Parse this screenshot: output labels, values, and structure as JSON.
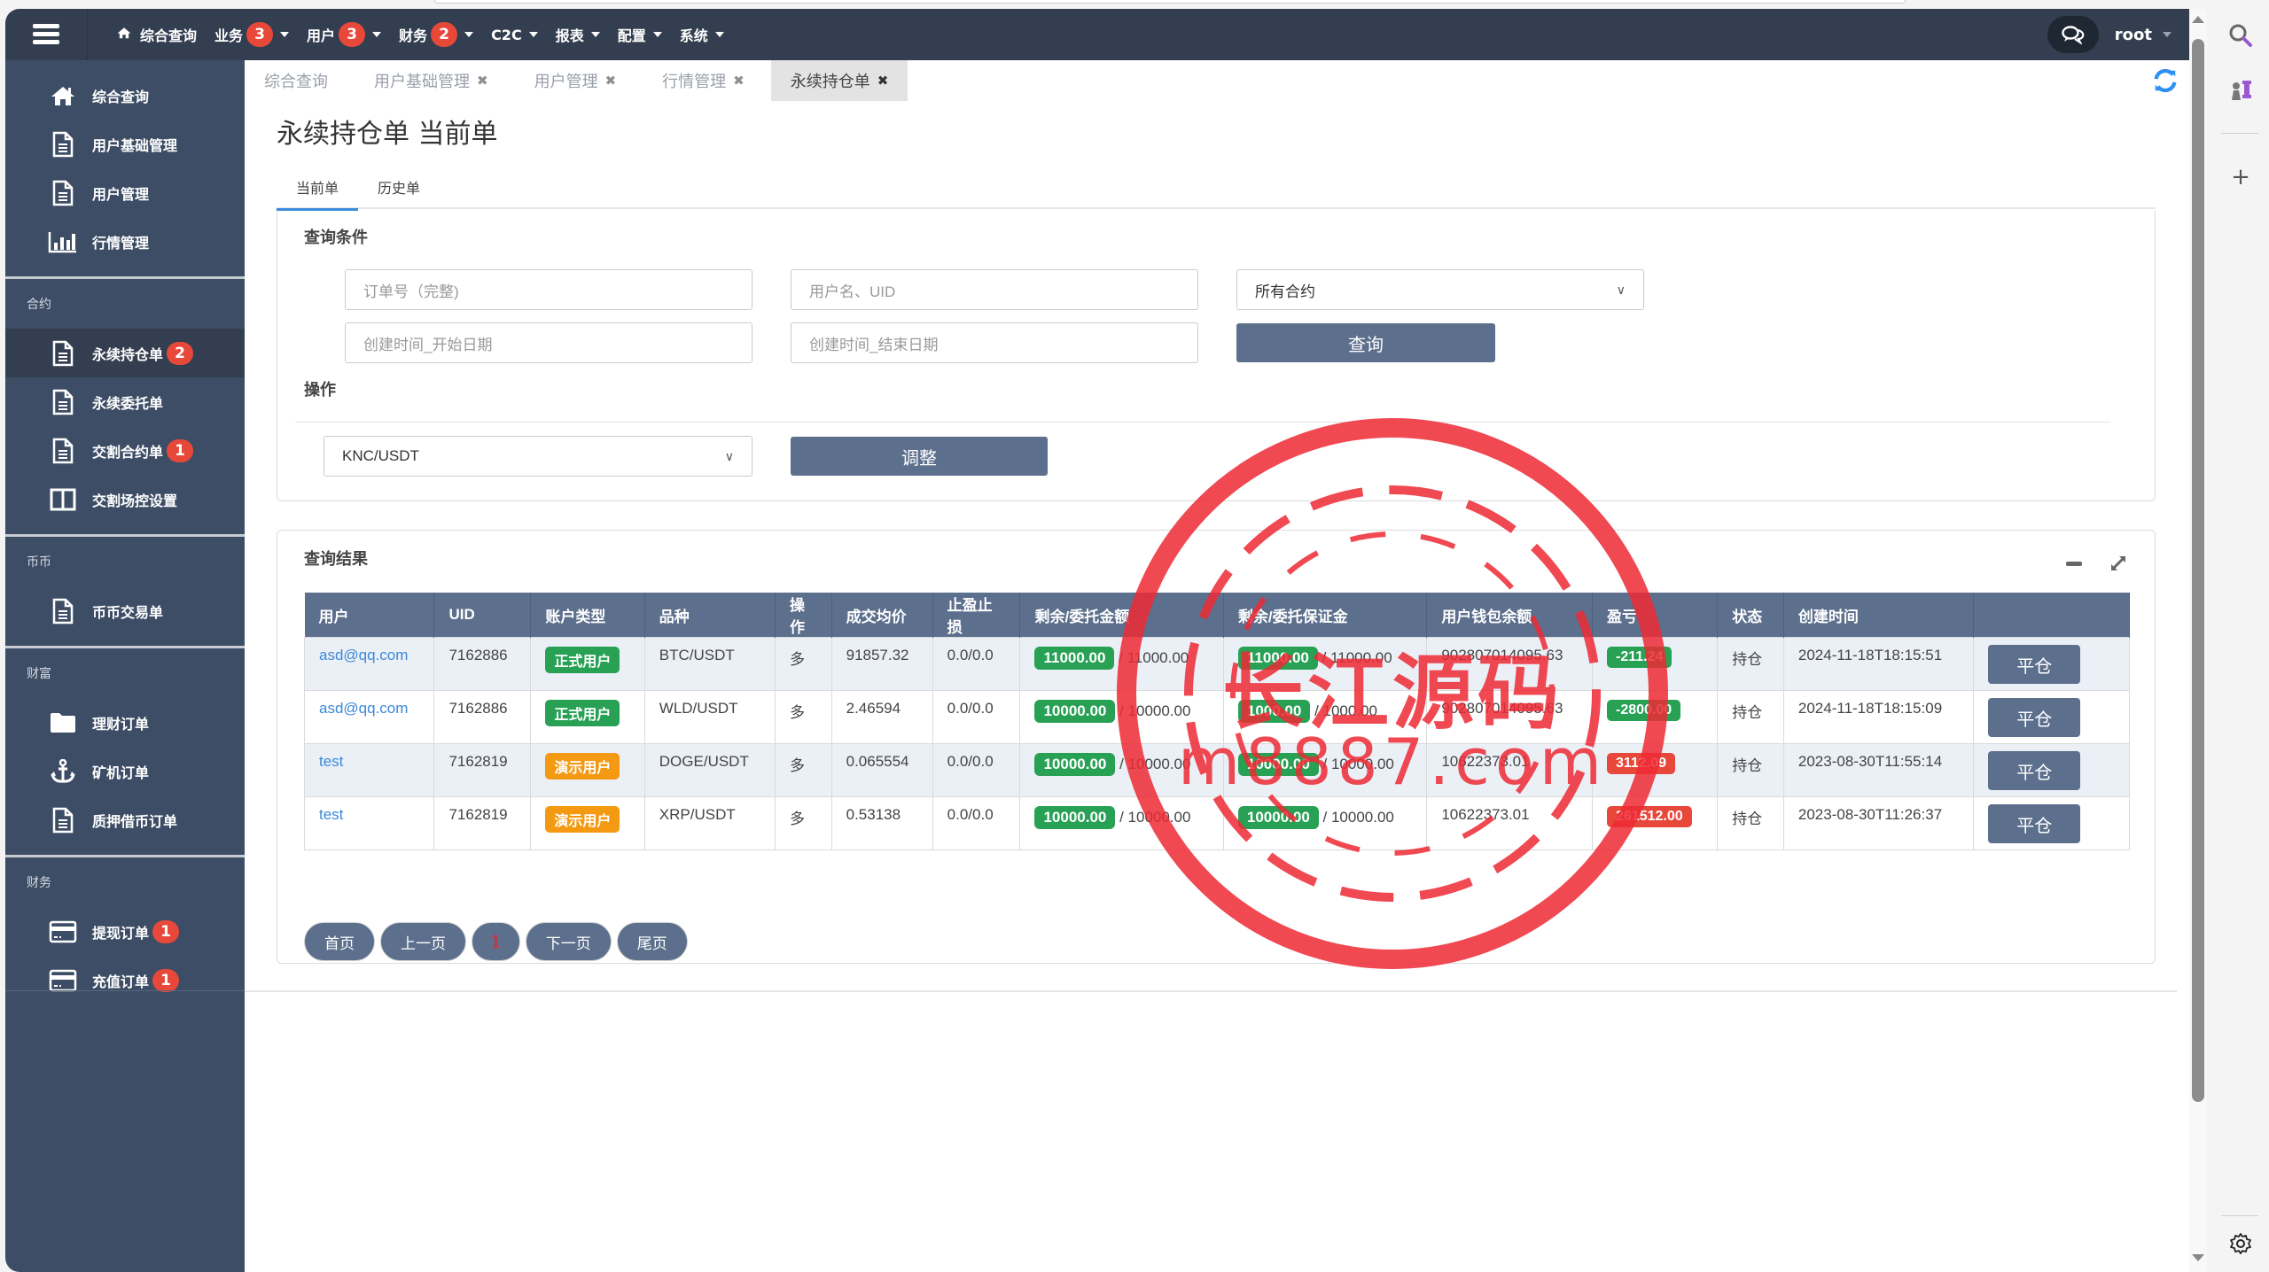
{
  "topnav": {
    "items": [
      {
        "label": "综合查询",
        "icon": "home-icon",
        "badge": null,
        "dropdown": false
      },
      {
        "label": "业务",
        "badge": "3",
        "dropdown": true
      },
      {
        "label": "用户",
        "badge": "3",
        "dropdown": true
      },
      {
        "label": "财务",
        "badge": "2",
        "dropdown": true
      },
      {
        "label": "C2C",
        "badge": null,
        "dropdown": true
      },
      {
        "label": "报表",
        "badge": null,
        "dropdown": true
      },
      {
        "label": "配置",
        "badge": null,
        "dropdown": true
      },
      {
        "label": "系统",
        "badge": null,
        "dropdown": true
      }
    ],
    "user": "root",
    "chat_icon": "chat-bubbles-icon"
  },
  "sidebar": {
    "top_items": [
      {
        "label": "综合查询",
        "icon": "home-icon"
      },
      {
        "label": "用户基础管理",
        "icon": "document-icon"
      },
      {
        "label": "用户管理",
        "icon": "document-icon"
      },
      {
        "label": "行情管理",
        "icon": "bar-chart-icon"
      }
    ],
    "groups": [
      {
        "title": "合约",
        "items": [
          {
            "label": "永续持仓单",
            "icon": "document-icon",
            "badge": "2",
            "active": true
          },
          {
            "label": "永续委托单",
            "icon": "document-icon",
            "badge": null
          },
          {
            "label": "交割合约单",
            "icon": "document-icon",
            "badge": "1"
          },
          {
            "label": "交割场控设置",
            "icon": "columns-icon",
            "badge": null
          }
        ]
      },
      {
        "title": "币币",
        "items": [
          {
            "label": "币币交易单",
            "icon": "document-icon",
            "badge": null
          }
        ]
      },
      {
        "title": "财富",
        "items": [
          {
            "label": "理财订单",
            "icon": "folder-icon",
            "badge": null
          },
          {
            "label": "矿机订单",
            "icon": "anchor-icon",
            "badge": null
          },
          {
            "label": "质押借币订单",
            "icon": "document-icon",
            "badge": null
          }
        ]
      },
      {
        "title": "财务",
        "items": [
          {
            "label": "提现订单",
            "icon": "credit-card-icon",
            "badge": "1"
          },
          {
            "label": "充值订单",
            "icon": "credit-card-icon",
            "badge": "1"
          }
        ]
      }
    ]
  },
  "tabs": [
    {
      "label": "综合查询",
      "closable": false,
      "active": false
    },
    {
      "label": "用户基础管理",
      "closable": true,
      "active": false
    },
    {
      "label": "用户管理",
      "closable": true,
      "active": false
    },
    {
      "label": "行情管理",
      "closable": true,
      "active": false
    },
    {
      "label": "永续持仓单",
      "closable": true,
      "active": true
    }
  ],
  "tab_close_glyph": "✖",
  "page_title": "永续持仓单 当前单",
  "subtabs": [
    {
      "label": "当前单",
      "active": true
    },
    {
      "label": "历史单",
      "active": false
    }
  ],
  "query": {
    "title": "查询条件",
    "order_no_placeholder": "订单号（完整)",
    "user_placeholder": "用户名、UID",
    "contract_select": "所有合约",
    "start_date_placeholder": "创建时间_开始日期",
    "end_date_placeholder": "创建时间_结束日期",
    "search_button": "查询"
  },
  "operation": {
    "title": "操作",
    "pair_select": "KNC/USDT",
    "adjust_button": "调整"
  },
  "results": {
    "title": "查询结果",
    "columns": [
      "用户",
      "UID",
      "账户类型",
      "品种",
      "操作",
      "成交均价",
      "止盈止损",
      "剩余/委托金额",
      "剩余/委托保证金",
      "用户钱包余额",
      "盈亏",
      "状态",
      "创建时间",
      ""
    ],
    "rows": [
      {
        "user": "asd@qq.com",
        "uid": "7162886",
        "account_type": "正式用户",
        "account_type_color": "#28a155",
        "symbol": "BTC/USDT",
        "side": "多",
        "avg_price": "91857.32",
        "tp_sl": "0.0/0.0",
        "remain_amount": "11000.00",
        "order_amount": "/ 11000.00",
        "remain_margin": "11000.00",
        "order_margin": "/ 11000.00",
        "wallet_balance": "902807014095.63",
        "pnl": "-211.24",
        "pnl_color": "#28a155",
        "status": "持仓",
        "created": "2024-11-18T18:15:51",
        "action": "平仓"
      },
      {
        "user": "asd@qq.com",
        "uid": "7162886",
        "account_type": "正式用户",
        "account_type_color": "#28a155",
        "symbol": "WLD/USDT",
        "side": "多",
        "avg_price": "2.46594",
        "tp_sl": "0.0/0.0",
        "remain_amount": "10000.00",
        "order_amount": "/ 10000.00",
        "remain_margin": "1000.00",
        "order_margin": "/ 1000.00",
        "wallet_balance": "902807014095.63",
        "pnl": "-2800.00",
        "pnl_color": "#28a155",
        "status": "持仓",
        "created": "2024-11-18T18:15:09",
        "action": "平仓"
      },
      {
        "user": "test",
        "uid": "7162819",
        "account_type": "演示用户",
        "account_type_color": "#f39a12",
        "symbol": "DOGE/USDT",
        "side": "多",
        "avg_price": "0.065554",
        "tp_sl": "0.0/0.0",
        "remain_amount": "10000.00",
        "order_amount": "/ 10000.00",
        "remain_margin": "10000.00",
        "order_margin": "/ 10000.00",
        "wallet_balance": "10622373.01",
        "pnl": "3112.09",
        "pnl_color": "#e8483a",
        "status": "持仓",
        "created": "2023-08-30T11:55:14",
        "action": "平仓"
      },
      {
        "user": "test",
        "uid": "7162819",
        "account_type": "演示用户",
        "account_type_color": "#f39a12",
        "symbol": "XRP/USDT",
        "side": "多",
        "avg_price": "0.53138",
        "tp_sl": "0.0/0.0",
        "remain_amount": "10000.00",
        "order_amount": "/ 10000.00",
        "remain_margin": "10000.00",
        "order_margin": "/ 10000.00",
        "wallet_balance": "10622373.01",
        "pnl": "261512.00",
        "pnl_color": "#e8483a",
        "status": "持仓",
        "created": "2023-08-30T11:26:37",
        "action": "平仓"
      }
    ]
  },
  "pagination": {
    "first": "首页",
    "prev": "上一页",
    "current": "1",
    "next": "下一页",
    "last": "尾页"
  },
  "watermark": {
    "line1": "长江源码",
    "line2": "m8887.com"
  },
  "colors": {
    "navbar": "#333f50",
    "sidebar": "#3d4d65",
    "primary_button": "#5c6f8c",
    "badge": "#e8483a",
    "success": "#28a155",
    "warning": "#f39a12",
    "link": "#3a88d8",
    "refresh": "#2e8ff0"
  }
}
